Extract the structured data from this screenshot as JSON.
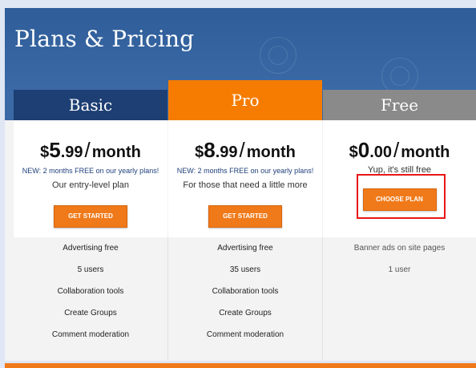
{
  "page": {
    "title": "Plans & Pricing"
  },
  "plans": [
    {
      "name": "Basic",
      "price": {
        "currency": "$",
        "whole": "5",
        "cents": ".99",
        "slash": "/",
        "period": "month"
      },
      "promo": "NEW: 2 months FREE on our yearly plans!",
      "description": "Our entry-level plan",
      "button_label": "GET STARTED",
      "features": [
        "Advertising free",
        "5 users",
        "Collaboration tools",
        "Create Groups",
        "Comment moderation"
      ]
    },
    {
      "name": "Pro",
      "price": {
        "currency": "$",
        "whole": "8",
        "cents": ".99",
        "slash": "/",
        "period": "month"
      },
      "promo": "NEW: 2 months FREE on our yearly plans!",
      "description": "For those that need a little more",
      "button_label": "GET STARTED",
      "features": [
        "Advertising free",
        "35 users",
        "Collaboration tools",
        "Create Groups",
        "Comment moderation"
      ]
    },
    {
      "name": "Free",
      "price": {
        "currency": "$",
        "whole": "0",
        "cents": ".00",
        "slash": "/",
        "period": "month"
      },
      "description": "Yup, it's still free",
      "button_label": "CHOOSE PLAN",
      "features": [
        "Banner ads on site pages",
        "1 user"
      ]
    }
  ],
  "colors": {
    "hero_blue": "#3a68a3",
    "basic_header": "#1d3f73",
    "pro_header": "#f57c00",
    "free_header": "#8a8a8a",
    "button_orange": "#f07a1a",
    "highlight_red": "#e81717"
  }
}
